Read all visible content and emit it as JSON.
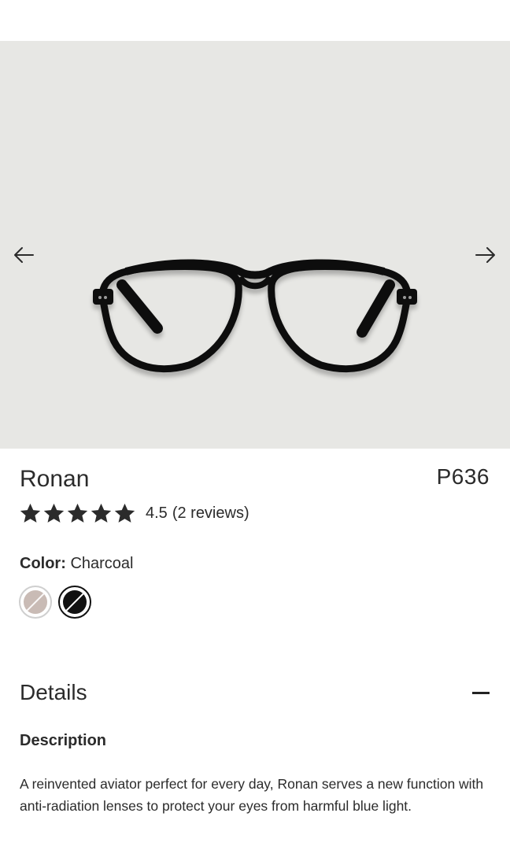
{
  "product": {
    "name": "Ronan",
    "sku": "P636",
    "rating": 4.5,
    "rating_value_text": "4.5",
    "reviews_text": "(2 reviews)",
    "stars_filled": 5
  },
  "color": {
    "label": "Color:",
    "selected": "Charcoal",
    "options": [
      {
        "name": "tan",
        "hex": "#c9bbb5",
        "selected": false
      },
      {
        "name": "charcoal",
        "hex": "#111111",
        "selected": true
      }
    ]
  },
  "gallery": {
    "background": "#e7e7e4",
    "prev_icon": "arrow-left-icon",
    "next_icon": "arrow-right-icon"
  },
  "details": {
    "title": "Details",
    "toggle_icon": "minus-icon",
    "description_label": "Description",
    "description_text": "A reinvented aviator perfect for every day, Ronan serves a new function with anti-radiation lenses to protect your eyes from harmful blue light."
  }
}
